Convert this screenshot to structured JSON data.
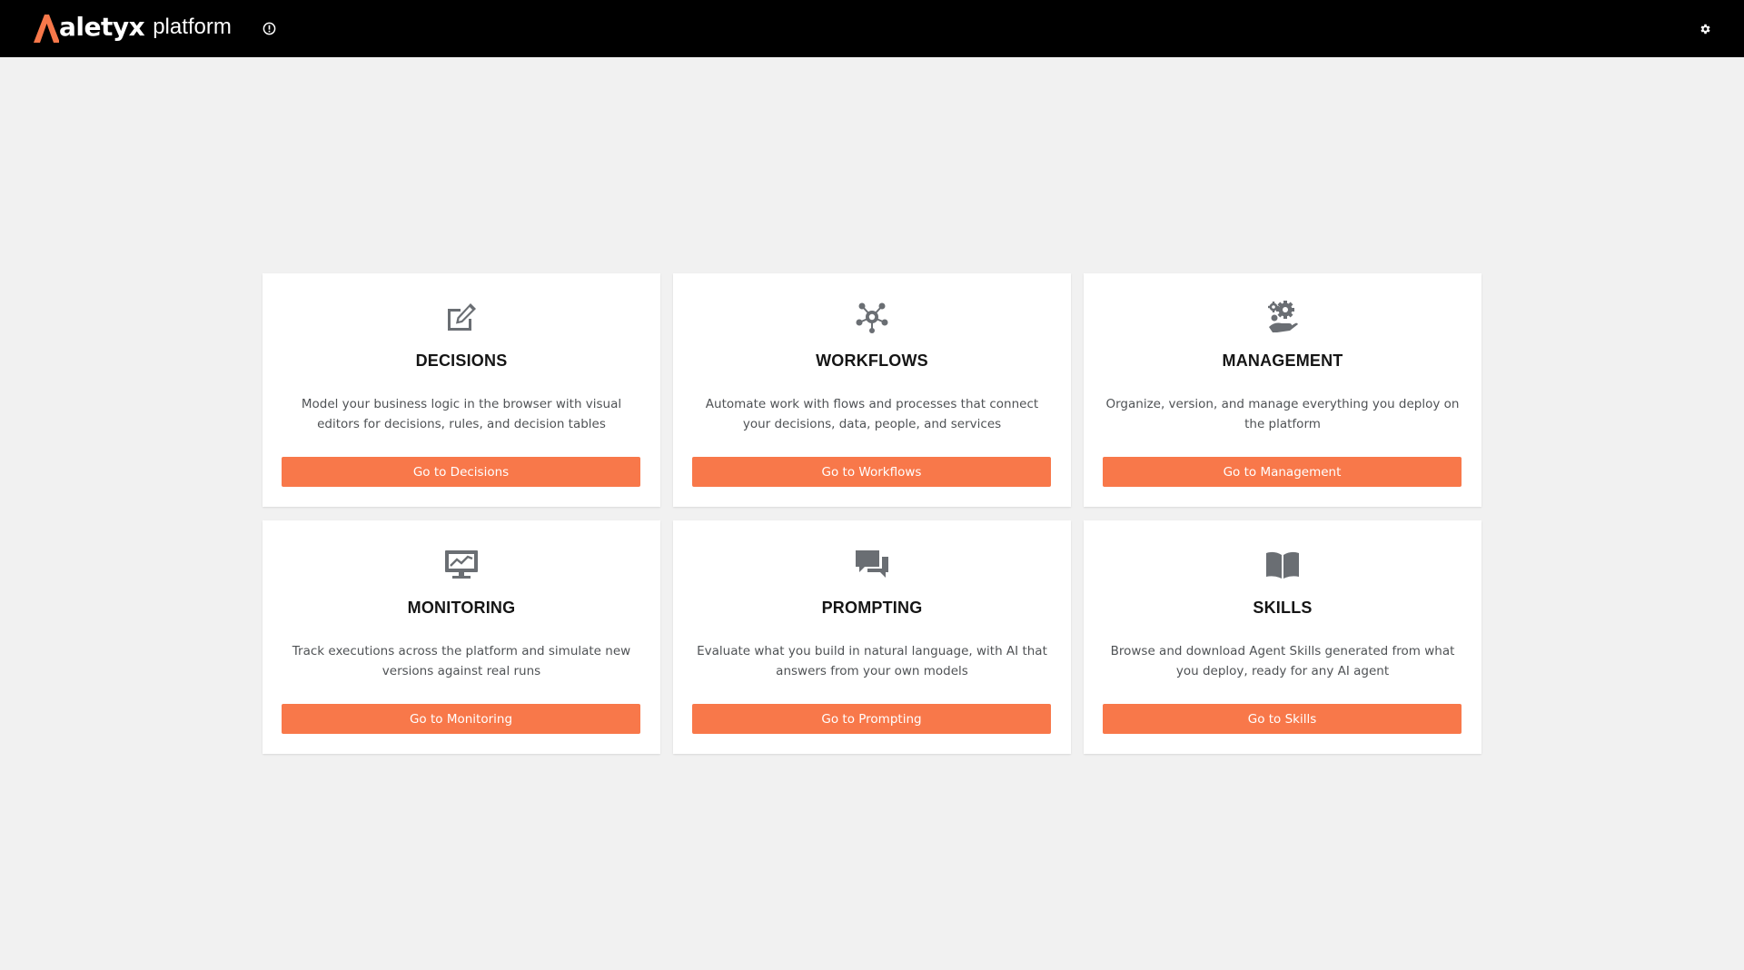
{
  "header": {
    "brand_name": "aletyx",
    "brand_suffix": "platform",
    "background_color": "#000000",
    "logo_accent_color": "#f8784a",
    "info_icon": "info-circle-icon",
    "settings_icon": "gear-icon"
  },
  "accent_color": "#f8784a",
  "cards": [
    {
      "icon": "edit-icon",
      "title": "DECISIONS",
      "description": "Model your business logic in the browser with visual editors for decisions, rules, and decision tables",
      "button_label": "Go to Decisions"
    },
    {
      "icon": "workflow-network-icon",
      "title": "WORKFLOWS",
      "description": "Automate work with flows and processes that connect your decisions, data, people, and services",
      "button_label": "Go to Workflows"
    },
    {
      "icon": "management-gears-hand-icon",
      "title": "MANAGEMENT",
      "description": "Organize, version, and manage everything you deploy on the platform",
      "button_label": "Go to Management"
    },
    {
      "icon": "monitoring-screen-icon",
      "title": "MONITORING",
      "description": "Track executions across the platform and simulate new versions against real runs",
      "button_label": "Go to Monitoring"
    },
    {
      "icon": "chat-bubbles-icon",
      "title": "PROMPTING",
      "description": "Evaluate what you build in natural language, with AI that answers from your own models",
      "button_label": "Go to Prompting"
    },
    {
      "icon": "open-book-icon",
      "title": "SKILLS",
      "description": "Browse and download Agent Skills generated from what you deploy, ready for any AI agent",
      "button_label": "Go to Skills"
    }
  ]
}
